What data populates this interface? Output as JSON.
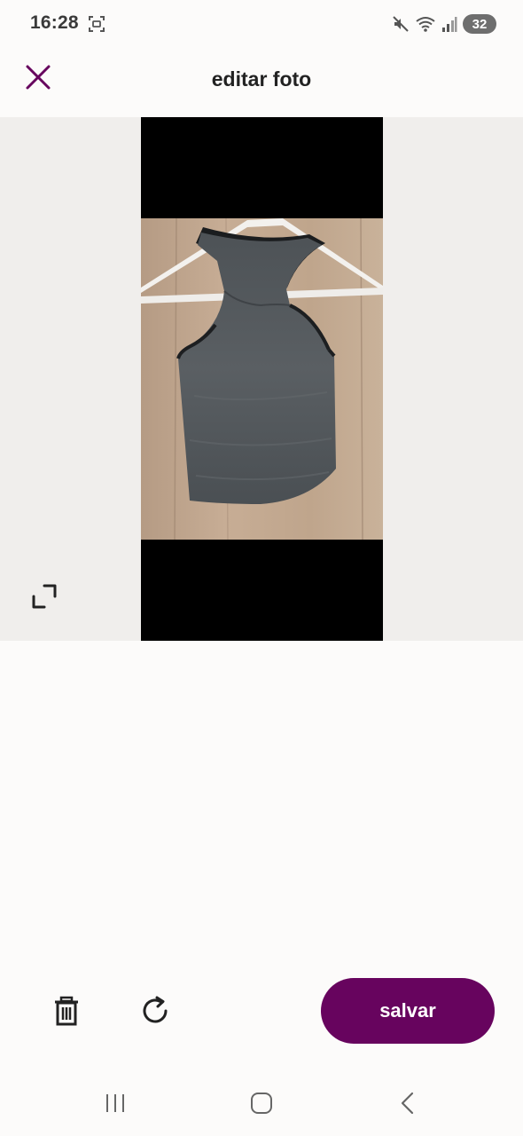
{
  "status_bar": {
    "time": "16:28",
    "battery": "32",
    "icons": [
      "screenshot-icon",
      "mute-icon",
      "wifi-icon",
      "signal-icon",
      "battery-icon"
    ]
  },
  "header": {
    "title": "editar foto",
    "close_icon": "close-icon",
    "accent_color": "#67045e"
  },
  "editor": {
    "photo_description_icon": "photo-preview",
    "crop_icon": "crop-expand-icon"
  },
  "toolbar": {
    "delete_icon": "trash-icon",
    "rotate_icon": "rotate-icon",
    "save_label": "salvar",
    "save_color": "#67045e"
  },
  "nav_bar": {
    "recents_icon": "recents-icon",
    "home_icon": "home-icon",
    "back_icon": "back-icon"
  }
}
